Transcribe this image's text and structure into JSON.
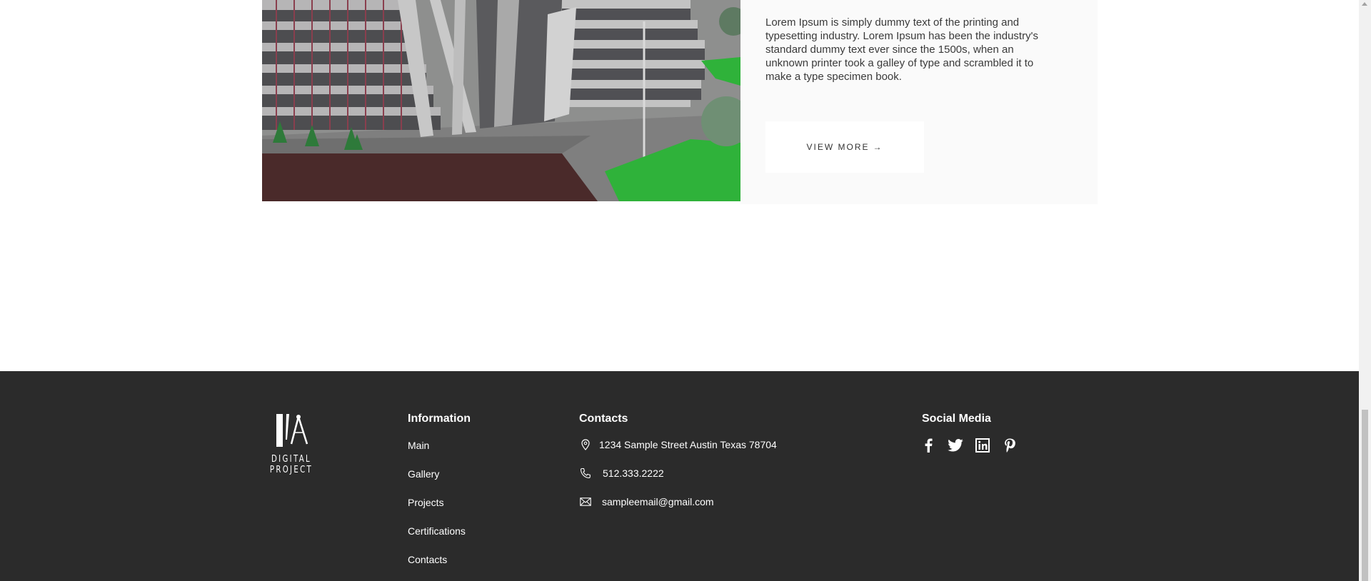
{
  "project": {
    "description": "Lorem Ipsum is simply dummy text of the printing and typesetting industry. Lorem Ipsum has been the industry's standard dummy text ever since the 1500s, when an unknown printer took a galley of type and scrambled it to make a type specimen book.",
    "button_label": "VIEW MORE",
    "button_icon": "→"
  },
  "footer": {
    "logo_text": "DIGITAL PROJECT",
    "information": {
      "title": "Information",
      "links": [
        "Main",
        "Gallery",
        "Projects",
        "Certifications",
        "Contacts"
      ]
    },
    "contacts": {
      "title": "Contacts",
      "address": "1234 Sample Street Austin Texas 78704",
      "phone": "512.333.2222",
      "email": "sampleemail@gmail.com"
    },
    "social": {
      "title": "Social Media",
      "icons": [
        "facebook-icon",
        "twitter-icon",
        "linkedin-icon",
        "pinterest-icon"
      ]
    },
    "colors": {
      "background": "#2b2b2b",
      "text": "#ffffff"
    }
  }
}
